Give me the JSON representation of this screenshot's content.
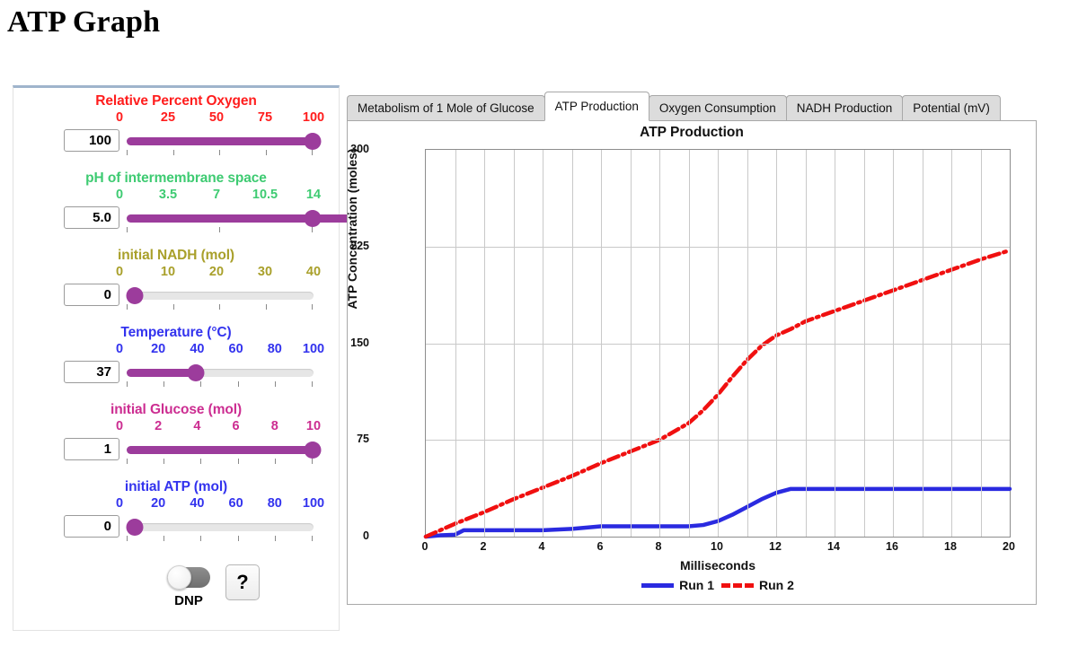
{
  "page": {
    "title": "ATP Graph"
  },
  "controls": {
    "sliders": [
      {
        "name": "relative-percent-oxygen",
        "title": "Relative Percent Oxygen",
        "color": "#ff1d1d",
        "value": "100",
        "min": 0,
        "max": 100,
        "position": 100,
        "ticks": [
          "0",
          "25",
          "50",
          "75",
          "100"
        ],
        "minor_ticks": 5
      },
      {
        "name": "ph-intermembrane-space",
        "title": "pH of intermembrane space",
        "color": "#3ecb72",
        "value": "5.0",
        "min": 0,
        "max": 14,
        "position": 35.7,
        "ticks": [
          "0",
          "3.5",
          "7",
          "10.5",
          "14"
        ],
        "minor_ticks": 3
      },
      {
        "name": "initial-nadh",
        "title": "initial NADH (mol)",
        "color": "#a9a02b",
        "value": "0",
        "min": 0,
        "max": 40,
        "position": 0,
        "ticks": [
          "0",
          "10",
          "20",
          "30",
          "40"
        ],
        "minor_ticks": 5
      },
      {
        "name": "temperature",
        "title": "Temperature (°C)",
        "color": "#3333ee",
        "value": "37",
        "min": 0,
        "max": 100,
        "position": 37,
        "ticks": [
          "0",
          "20",
          "40",
          "60",
          "80",
          "100"
        ],
        "minor_ticks": 6
      },
      {
        "name": "initial-glucose",
        "title": "initial Glucose (mol)",
        "color": "#cc2d91",
        "value": "1",
        "min": 0,
        "max": 10,
        "position": 10,
        "ticks": [
          "0",
          "2",
          "4",
          "6",
          "8",
          "10"
        ],
        "minor_ticks": 6
      },
      {
        "name": "initial-atp",
        "title": "initial ATP (mol)",
        "color": "#3333ee",
        "value": "0",
        "min": 0,
        "max": 100,
        "position": 0,
        "ticks": [
          "0",
          "20",
          "40",
          "60",
          "80",
          "100"
        ],
        "minor_ticks": 6
      }
    ],
    "toggle": {
      "label": "DNP",
      "state": "off"
    },
    "help_button": {
      "label": "?"
    }
  },
  "tabs": [
    {
      "label": "Metabolism of 1 Mole of Glucose",
      "active": false
    },
    {
      "label": "ATP Production",
      "active": true
    },
    {
      "label": "Oxygen Consumption",
      "active": false
    },
    {
      "label": "NADH Production",
      "active": false
    },
    {
      "label": "Potential (mV)",
      "active": false
    }
  ],
  "chart_data": {
    "type": "line",
    "title": "ATP Production",
    "xlabel": "Milliseconds",
    "ylabel": "ATP Concentration (moles)",
    "xlim": [
      0,
      20
    ],
    "ylim": [
      0,
      300
    ],
    "xticks": [
      "0",
      "2",
      "4",
      "6",
      "8",
      "10",
      "12",
      "14",
      "16",
      "18",
      "20"
    ],
    "yticks": [
      "0",
      "75",
      "150",
      "225",
      "300"
    ],
    "grid": true,
    "legend_position": "bottom",
    "series": [
      {
        "name": "Run 1",
        "color": "#2a2ae0",
        "style": "solid",
        "x": [
          0,
          0.5,
          1,
          1.3,
          2,
          3,
          4,
          5,
          6,
          7,
          8,
          9,
          9.5,
          10,
          10.5,
          11,
          11.5,
          12,
          12.5,
          14,
          16,
          18,
          20
        ],
        "y": [
          0,
          1,
          1.5,
          5,
          5,
          5,
          5,
          6,
          8,
          8,
          8,
          8,
          9,
          12,
          17,
          23,
          29,
          34,
          37,
          37,
          37,
          37,
          37
        ]
      },
      {
        "name": "Run 2",
        "color": "#f01010",
        "style": "dashdot",
        "x": [
          0,
          1,
          2,
          3,
          4,
          5,
          6,
          7,
          8,
          9,
          9.5,
          10,
          10.5,
          11,
          11.5,
          12,
          12.5,
          13,
          14,
          15,
          16,
          17,
          18,
          19,
          20
        ],
        "y": [
          0,
          10,
          19,
          29,
          38,
          47,
          57,
          66,
          75,
          88,
          98,
          110,
          124,
          137,
          148,
          156,
          161,
          167,
          175,
          183,
          191,
          199,
          207,
          215,
          222
        ]
      }
    ]
  }
}
